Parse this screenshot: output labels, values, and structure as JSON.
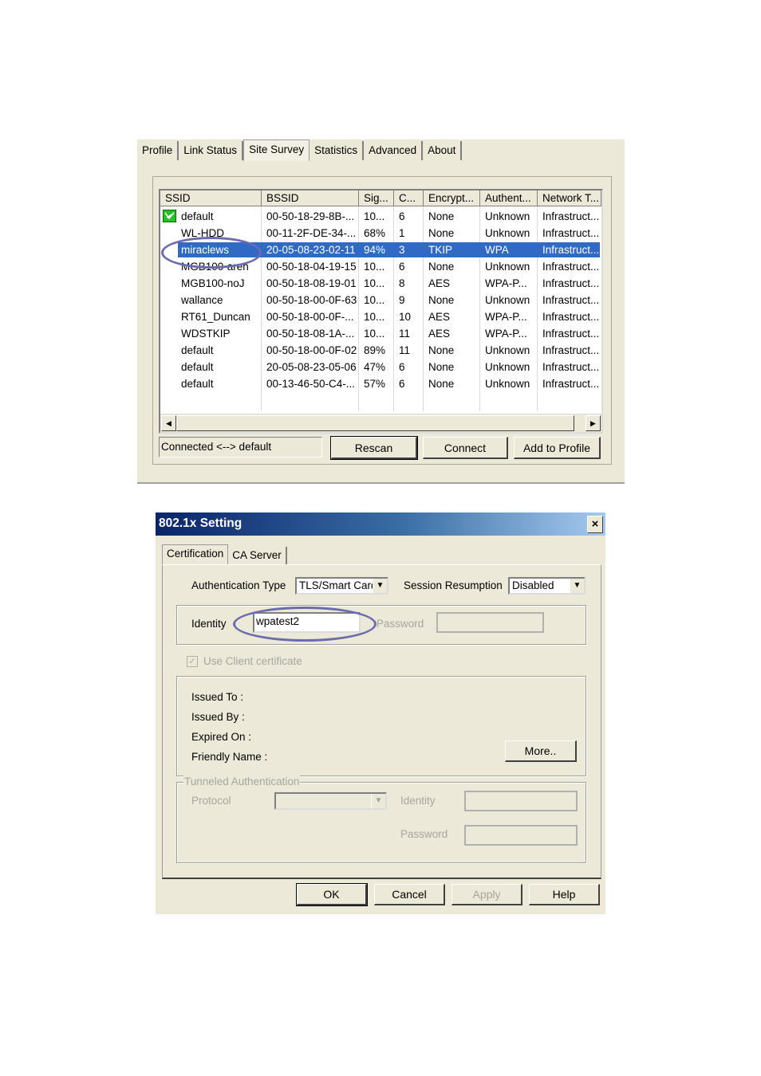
{
  "survey": {
    "tabs": [
      "Profile",
      "Link Status",
      "Site Survey",
      "Statistics",
      "Advanced",
      "About"
    ],
    "active_tab": "Site Survey",
    "columns": [
      "SSID",
      "BSSID",
      "Sig...",
      "C...",
      "Encrypt...",
      "Authent...",
      "Network T..."
    ],
    "rows": [
      {
        "ssid": "default",
        "bssid": "00-50-18-29-8B-...",
        "sig": "10...",
        "ch": "6",
        "enc": "None",
        "auth": "Unknown",
        "net": "Infrastruct...",
        "connected": true
      },
      {
        "ssid": "WL-HDD",
        "bssid": "00-11-2F-DE-34-...",
        "sig": "68%",
        "ch": "1",
        "enc": "None",
        "auth": "Unknown",
        "net": "Infrastruct..."
      },
      {
        "ssid": "miraclews",
        "bssid": "20-05-08-23-02-11",
        "sig": "94%",
        "ch": "3",
        "enc": "TKIP",
        "auth": "WPA",
        "net": "Infrastruct...",
        "selected": true
      },
      {
        "ssid": "MGB100-aren",
        "bssid": "00-50-18-04-19-15",
        "sig": "10...",
        "ch": "6",
        "enc": "None",
        "auth": "Unknown",
        "net": "Infrastruct..."
      },
      {
        "ssid": "MGB100-noJ",
        "bssid": "00-50-18-08-19-01",
        "sig": "10...",
        "ch": "8",
        "enc": "AES",
        "auth": "WPA-P...",
        "net": "Infrastruct..."
      },
      {
        "ssid": "wallance",
        "bssid": "00-50-18-00-0F-63",
        "sig": "10...",
        "ch": "9",
        "enc": "None",
        "auth": "Unknown",
        "net": "Infrastruct..."
      },
      {
        "ssid": "RT61_Duncan",
        "bssid": "00-50-18-00-0F-...",
        "sig": "10...",
        "ch": "10",
        "enc": "AES",
        "auth": "WPA-P...",
        "net": "Infrastruct..."
      },
      {
        "ssid": "WDSTKIP",
        "bssid": "00-50-18-08-1A-...",
        "sig": "10...",
        "ch": "11",
        "enc": "AES",
        "auth": "WPA-P...",
        "net": "Infrastruct..."
      },
      {
        "ssid": "default",
        "bssid": "00-50-18-00-0F-02",
        "sig": "89%",
        "ch": "11",
        "enc": "None",
        "auth": "Unknown",
        "net": "Infrastruct..."
      },
      {
        "ssid": "default",
        "bssid": "20-05-08-23-05-06",
        "sig": "47%",
        "ch": "6",
        "enc": "None",
        "auth": "Unknown",
        "net": "Infrastruct..."
      },
      {
        "ssid": "default",
        "bssid": "00-13-46-50-C4-...",
        "sig": "57%",
        "ch": "6",
        "enc": "None",
        "auth": "Unknown",
        "net": "Infrastruct..."
      }
    ],
    "status_text": "Connected <--> default",
    "buttons": {
      "rescan": "Rescan",
      "connect": "Connect",
      "add_to_profile": "Add to Profile"
    },
    "selection_color": "#316ac5"
  },
  "dialog": {
    "title": "802.1x Setting",
    "close_glyph": "×",
    "tabs": [
      "Certification",
      "CA Server"
    ],
    "auth_type_label": "Authentication Type",
    "auth_type_value": "TLS/Smart Card",
    "session_label": "Session Resumption",
    "session_value": "Disabled",
    "identity_label": "Identity",
    "identity_value": "wpatest2",
    "password_label": "Password",
    "use_client_cert_label": "Use Client certificate",
    "use_client_cert_checked": true,
    "cert_labels": {
      "issued_to": "Issued To :",
      "issued_by": "Issued By :",
      "expired_on": "Expired On :",
      "friendly_name": "Friendly Name :"
    },
    "more_button": "More..",
    "tunneled": {
      "legend": "Tunneled Authentication",
      "protocol_label": "Protocol",
      "identity_label": "Identity",
      "password_label": "Password"
    },
    "buttons": {
      "ok": "OK",
      "cancel": "Cancel",
      "apply": "Apply",
      "help": "Help"
    },
    "highlight_color": "#6b6bb0"
  }
}
